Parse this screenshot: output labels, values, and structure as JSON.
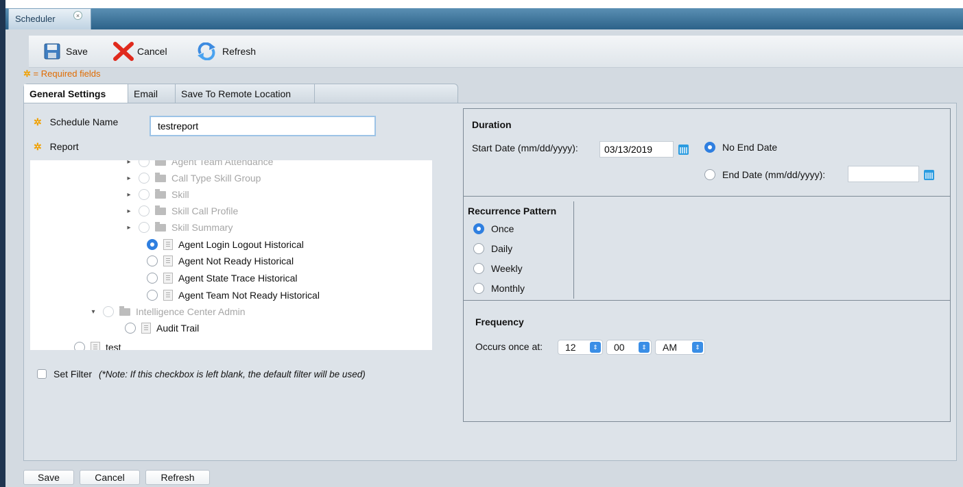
{
  "window": {
    "tab_title": "Scheduler",
    "tab_close": "×"
  },
  "toolbar": {
    "save": "Save",
    "cancel": "Cancel",
    "refresh": "Refresh"
  },
  "required_note": "= Required fields",
  "tabs": [
    {
      "label": "General Settings",
      "active": true
    },
    {
      "label": "Email",
      "active": false
    },
    {
      "label": "Save To Remote Location",
      "active": false
    }
  ],
  "general": {
    "schedule_name_label": "Schedule Name",
    "schedule_name_value": "testreport",
    "report_label": "Report",
    "tree": [
      {
        "label": "Agent Team Attendance",
        "dim": true,
        "type": "folder",
        "arrow": "▸"
      },
      {
        "label": "Call Type Skill Group",
        "dim": true,
        "type": "folder",
        "arrow": "▸"
      },
      {
        "label": "Skill",
        "dim": true,
        "type": "folder",
        "arrow": "▸"
      },
      {
        "label": "Skill Call Profile",
        "dim": true,
        "type": "folder",
        "arrow": "▸"
      },
      {
        "label": "Skill Summary",
        "dim": true,
        "type": "folder",
        "arrow": "▸"
      },
      {
        "label": "Agent Login Logout Historical",
        "dim": false,
        "type": "doc",
        "selected": true
      },
      {
        "label": "Agent Not Ready Historical",
        "dim": false,
        "type": "doc"
      },
      {
        "label": "Agent State Trace Historical",
        "dim": false,
        "type": "doc"
      },
      {
        "label": "Agent Team Not Ready Historical",
        "dim": false,
        "type": "doc"
      },
      {
        "label": "Intelligence Center Admin",
        "dim": true,
        "type": "folder",
        "arrow": "▾"
      },
      {
        "label": "Audit Trail",
        "dim": false,
        "type": "doc"
      },
      {
        "label": "test",
        "dim": false,
        "type": "doc"
      }
    ],
    "set_filter_label": "Set Filter",
    "set_filter_note": "(*Note: If this checkbox is left blank, the default filter will be used)"
  },
  "duration": {
    "title": "Duration",
    "start_label": "Start Date (mm/dd/yyyy):",
    "start_value": "03/13/2019",
    "no_end_label": "No End Date",
    "end_label": "End Date (mm/dd/yyyy):",
    "end_value": ""
  },
  "recurrence": {
    "title": "Recurrence Pattern",
    "options": [
      "Once",
      "Daily",
      "Weekly",
      "Monthly"
    ],
    "selected": "Once"
  },
  "frequency": {
    "title": "Frequency",
    "label": "Occurs once at:",
    "hour": "12",
    "minute": "00",
    "ampm": "AM"
  },
  "bottom_buttons": {
    "save": "Save",
    "cancel": "Cancel",
    "refresh": "Refresh"
  },
  "colors": {
    "accent": "#2f7fe0",
    "required": "#e06b00",
    "tabbar": "#2c6289"
  }
}
